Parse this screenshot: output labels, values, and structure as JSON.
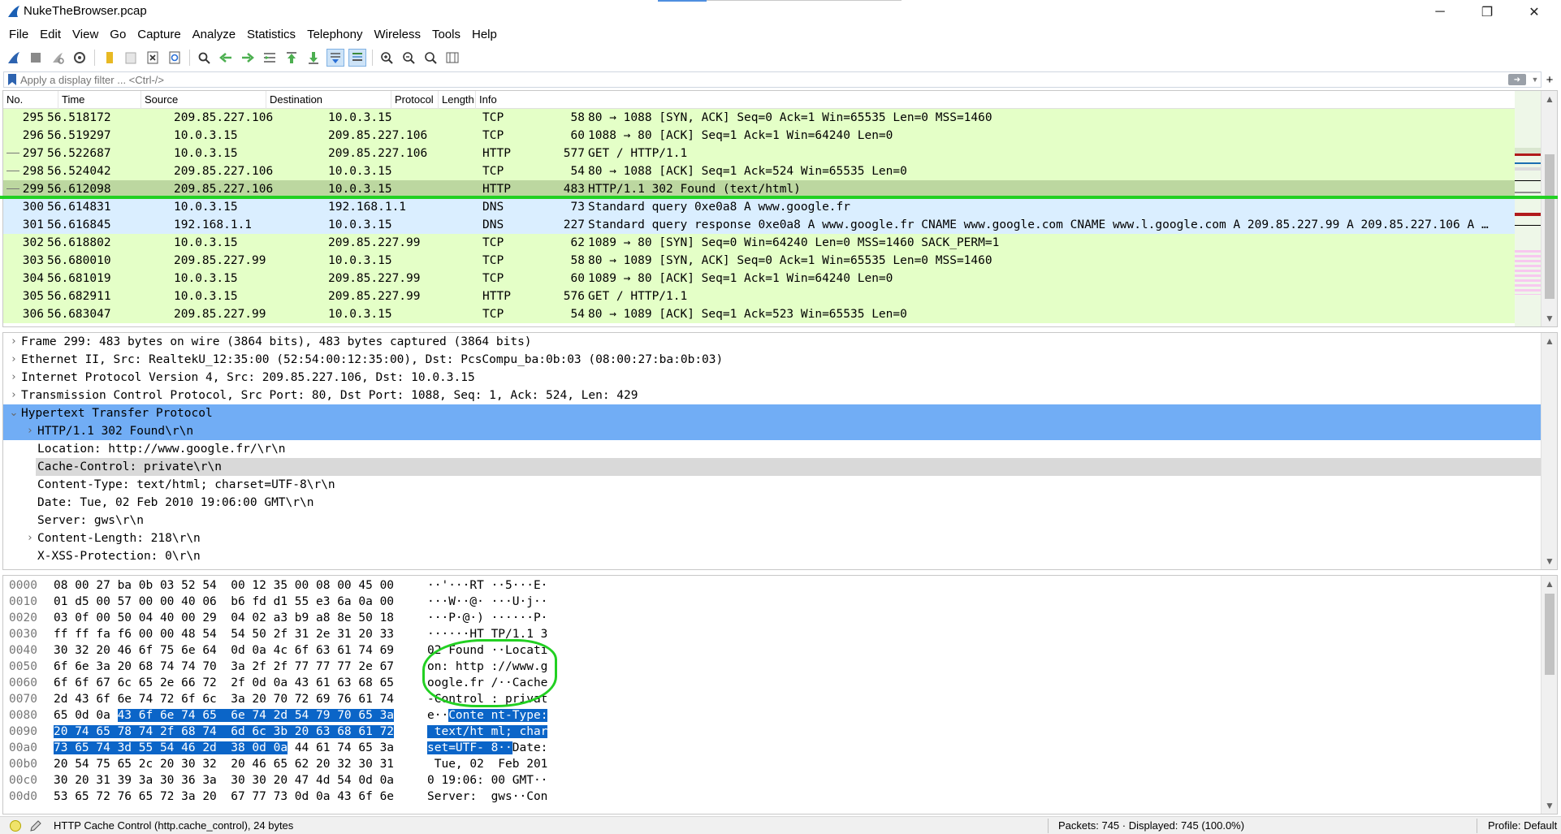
{
  "window": {
    "title": "NukeTheBrowser.pcap",
    "minimize": "─",
    "restore": "❐",
    "close": "✕"
  },
  "menu": [
    "File",
    "Edit",
    "View",
    "Go",
    "Capture",
    "Analyze",
    "Statistics",
    "Telephony",
    "Wireless",
    "Tools",
    "Help"
  ],
  "toolbar": {
    "icons": [
      "shark-fin-start-icon",
      "stop-icon",
      "restart-icon",
      "options-gear-icon",
      "open-folder-icon",
      "save-icon",
      "close-file-icon",
      "reload-icon",
      "find-icon",
      "go-back-icon",
      "go-forward-icon",
      "go-to-packet-icon",
      "go-first-icon",
      "go-last-icon",
      "autoscroll-icon",
      "colorize-icon",
      "zoom-in-icon",
      "zoom-out-icon",
      "zoom-normal-icon",
      "resize-columns-icon"
    ]
  },
  "filter": {
    "placeholder": "Apply a display filter ... <Ctrl-/>",
    "plus": "+"
  },
  "packet_list": {
    "columns": [
      "No.",
      "Time",
      "Source",
      "Destination",
      "Protocol",
      "Length",
      "Info"
    ],
    "rows": [
      {
        "no": "295",
        "time": "56.518172",
        "src": "209.85.227.106",
        "dst": "10.0.3.15",
        "proto": "TCP",
        "len": "58",
        "info": "80 → 1088 [SYN, ACK] Seq=0 Ack=1 Win=65535 Len=0 MSS=1460",
        "color": "tcp"
      },
      {
        "no": "296",
        "time": "56.519297",
        "src": "10.0.3.15",
        "dst": "209.85.227.106",
        "proto": "TCP",
        "len": "60",
        "info": "1088 → 80 [ACK] Seq=1 Ack=1 Win=64240 Len=0",
        "color": "tcp"
      },
      {
        "no": "297",
        "time": "56.522687",
        "src": "10.0.3.15",
        "dst": "209.85.227.106",
        "proto": "HTTP",
        "len": "577",
        "info": "GET / HTTP/1.1",
        "color": "tcp"
      },
      {
        "no": "298",
        "time": "56.524042",
        "src": "209.85.227.106",
        "dst": "10.0.3.15",
        "proto": "TCP",
        "len": "54",
        "info": "80 → 1088 [ACK] Seq=1 Ack=524 Win=65535 Len=0",
        "color": "tcp"
      },
      {
        "no": "299",
        "time": "56.612098",
        "src": "209.85.227.106",
        "dst": "10.0.3.15",
        "proto": "HTTP",
        "len": "483",
        "info": "HTTP/1.1 302 Found  (text/html)",
        "color": "sel"
      },
      {
        "no": "300",
        "time": "56.614831",
        "src": "10.0.3.15",
        "dst": "192.168.1.1",
        "proto": "DNS",
        "len": "73",
        "info": "Standard query 0xe0a8 A www.google.fr",
        "color": "dns"
      },
      {
        "no": "301",
        "time": "56.616845",
        "src": "192.168.1.1",
        "dst": "10.0.3.15",
        "proto": "DNS",
        "len": "227",
        "info": "Standard query response 0xe0a8 A www.google.fr CNAME www.google.com CNAME www.l.google.com A 209.85.227.99 A 209.85.227.106 A …",
        "color": "dns"
      },
      {
        "no": "302",
        "time": "56.618802",
        "src": "10.0.3.15",
        "dst": "209.85.227.99",
        "proto": "TCP",
        "len": "62",
        "info": "1089 → 80 [SYN] Seq=0 Win=64240 Len=0 MSS=1460 SACK_PERM=1",
        "color": "tcp"
      },
      {
        "no": "303",
        "time": "56.680010",
        "src": "209.85.227.99",
        "dst": "10.0.3.15",
        "proto": "TCP",
        "len": "58",
        "info": "80 → 1089 [SYN, ACK] Seq=0 Ack=1 Win=65535 Len=0 MSS=1460",
        "color": "tcp"
      },
      {
        "no": "304",
        "time": "56.681019",
        "src": "10.0.3.15",
        "dst": "209.85.227.99",
        "proto": "TCP",
        "len": "60",
        "info": "1089 → 80 [ACK] Seq=1 Ack=1 Win=64240 Len=0",
        "color": "tcp"
      },
      {
        "no": "305",
        "time": "56.682911",
        "src": "10.0.3.15",
        "dst": "209.85.227.99",
        "proto": "HTTP",
        "len": "576",
        "info": "GET / HTTP/1.1",
        "color": "tcp"
      },
      {
        "no": "306",
        "time": "56.683047",
        "src": "209.85.227.99",
        "dst": "10.0.3.15",
        "proto": "TCP",
        "len": "54",
        "info": "80 → 1089 [ACK] Seq=1 Ack=523 Win=65535 Len=0",
        "color": "tcp"
      }
    ]
  },
  "details": [
    {
      "text": "Frame 299: 483 bytes on wire (3864 bits), 483 bytes captured (3864 bits)",
      "level": 0,
      "expander": "›",
      "style": ""
    },
    {
      "text": "Ethernet II, Src: RealtekU_12:35:00 (52:54:00:12:35:00), Dst: PcsCompu_ba:0b:03 (08:00:27:ba:0b:03)",
      "level": 0,
      "expander": "›",
      "style": ""
    },
    {
      "text": "Internet Protocol Version 4, Src: 209.85.227.106, Dst: 10.0.3.15",
      "level": 0,
      "expander": "›",
      "style": ""
    },
    {
      "text": "Transmission Control Protocol, Src Port: 80, Dst Port: 1088, Seq: 1, Ack: 524, Len: 429",
      "level": 0,
      "expander": "›",
      "style": ""
    },
    {
      "text": "Hypertext Transfer Protocol",
      "level": 0,
      "expander": "⌄",
      "style": "sel"
    },
    {
      "text": "HTTP/1.1 302 Found\\r\\n",
      "level": 1,
      "expander": "›",
      "style": "sel"
    },
    {
      "text": "Location: http://www.google.fr/\\r\\n",
      "level": 1,
      "expander": "",
      "style": ""
    },
    {
      "text": "Cache-Control: private\\r\\n",
      "level": 1,
      "expander": "",
      "style": "sel2"
    },
    {
      "text": "Content-Type: text/html; charset=UTF-8\\r\\n",
      "level": 1,
      "expander": "",
      "style": ""
    },
    {
      "text": "Date: Tue, 02 Feb 2010 19:06:00 GMT\\r\\n",
      "level": 1,
      "expander": "",
      "style": ""
    },
    {
      "text": "Server: gws\\r\\n",
      "level": 1,
      "expander": "",
      "style": ""
    },
    {
      "text": "Content-Length: 218\\r\\n",
      "level": 1,
      "expander": "›",
      "style": ""
    },
    {
      "text": "X-XSS-Protection: 0\\r\\n",
      "level": 1,
      "expander": "",
      "style": ""
    }
  ],
  "bytes": [
    {
      "off": "0000",
      "hex": [
        "08 00 27 ba 0b 03 52 54  00 12 35 00 08 00 45 00"
      ],
      "asc": [
        "··'···RT ··5···E·"
      ]
    },
    {
      "off": "0010",
      "hex": [
        "01 d5 00 57 00 00 40 06  b6 fd d1 55 e3 6a 0a 00"
      ],
      "asc": [
        "···W··@· ···U·j··"
      ]
    },
    {
      "off": "0020",
      "hex": [
        "03 0f 00 50 04 40 00 29  04 02 a3 b9 a8 8e 50 18"
      ],
      "asc": [
        "···P·@·) ······P·"
      ]
    },
    {
      "off": "0030",
      "hex": [
        "ff ff fa f6 00 00 48 54  54 50 2f 31 2e 31 20 33"
      ],
      "asc": [
        "······HT TP/1.1 3"
      ]
    },
    {
      "off": "0040",
      "hex": [
        "30 32 20 46 6f 75 6e 64  0d 0a 4c 6f 63 61 74 69"
      ],
      "asc": [
        "02 Found ··Locati"
      ]
    },
    {
      "off": "0050",
      "hex": [
        "6f 6e 3a 20 68 74 74 70  3a 2f 2f 77 77 77 2e 67"
      ],
      "asc": [
        "on: http ://www.g"
      ]
    },
    {
      "off": "0060",
      "hex": [
        "6f 6f 67 6c 65 2e 66 72  2f 0d 0a 43 61 63 68 65"
      ],
      "asc": [
        "oogle.fr /··Cache"
      ]
    },
    {
      "off": "0070",
      "hex": [
        "2d 43 6f 6e 74 72 6f 6c  3a 20 70 72 69 76 61 74"
      ],
      "asc": [
        "-Control : privat"
      ]
    },
    {
      "off": "0080",
      "hex": [
        "65 0d 0a ",
        "43 6f 6e 74 65  6e 74 2d 54 79 70 65 3a"
      ],
      "asc": [
        "e··",
        "Conte nt-Type:"
      ]
    },
    {
      "off": "0090",
      "hex": [
        "",
        "20 74 65 78 74 2f 68 74  6d 6c 3b 20 63 68 61 72"
      ],
      "asc": [
        "",
        " text/ht ml; char"
      ]
    },
    {
      "off": "00a0",
      "hex": [
        "",
        "73 65 74 3d 55 54 46 2d  38 0d 0a",
        " 44 61 74 65 3a"
      ],
      "asc": [
        "",
        "set=UTF- 8··",
        "Date:"
      ]
    },
    {
      "off": "00b0",
      "hex": [
        "20 54 75 65 2c 20 30 32  20 46 65 62 20 32 30 31"
      ],
      "asc": [
        " Tue, 02  Feb 201"
      ]
    },
    {
      "off": "00c0",
      "hex": [
        "30 20 31 39 3a 30 36 3a  30 30 20 47 4d 54 0d 0a"
      ],
      "asc": [
        "0 19:06: 00 GMT··"
      ]
    },
    {
      "off": "00d0",
      "hex": [
        "53 65 72 76 65 72 3a 20  67 77 73 0d 0a 43 6f 6e"
      ],
      "asc": [
        "Server:  gws··Con"
      ]
    }
  ],
  "status": {
    "field": "HTTP Cache Control (http.cache_control), 24 bytes",
    "packets": "Packets: 745 · Displayed: 745 (100.0%)",
    "profile": "Profile: Default"
  },
  "colors": {
    "tcp_row": "#e4ffc7",
    "dns_row": "#daeeff",
    "selected_row": "#bcd7a0",
    "tree_selected": "#71adf5",
    "byte_highlight": "#0b65c8",
    "annotation_green": "#22d022"
  }
}
